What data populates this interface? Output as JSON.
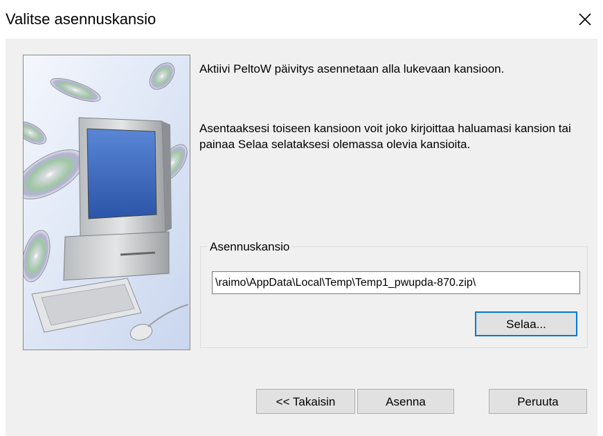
{
  "window": {
    "title": "Valitse asennuskansio"
  },
  "content": {
    "intro_text": "Aktiivi PeltoW päivitys asennetaan alla lukevaan kansioon.",
    "instructions_text": "Asentaaksesi toiseen kansioon voit joko kirjoittaa haluamasi kansion tai painaa Selaa selataksesi olemassa olevia kansioita."
  },
  "folder_group": {
    "label": "Asennuskansio",
    "path_value": "\\raimo\\AppData\\Local\\Temp\\Temp1_pwupda-870.zip\\",
    "browse_label": "Selaa..."
  },
  "buttons": {
    "back_label": "<< Takaisin",
    "install_label": "Asenna",
    "cancel_label": "Peruuta"
  },
  "icons": {
    "close": "close-icon",
    "illustration": "computer-with-cds-illustration"
  },
  "colors": {
    "dialog_bg": "#f0f0f0",
    "default_button_border": "#0078d7"
  }
}
